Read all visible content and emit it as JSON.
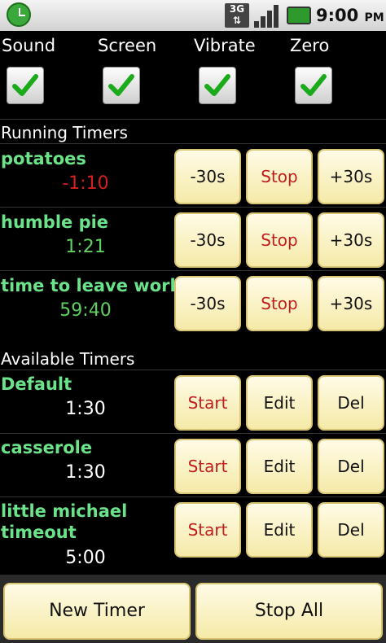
{
  "status_bar": {
    "network": "3G",
    "time": "9:00",
    "ampm": "PM"
  },
  "settings": {
    "sound": {
      "label": "Sound",
      "checked": true
    },
    "screen": {
      "label": "Screen",
      "checked": true
    },
    "vibrate": {
      "label": "Vibrate",
      "checked": true
    },
    "zero": {
      "label": "Zero",
      "checked": true
    }
  },
  "running_section": {
    "title": "Running Timers"
  },
  "running_timers": [
    {
      "name": "potatoes",
      "time": "-1:10",
      "time_color": "#d81f1f",
      "minus_label": "-30s",
      "stop_label": "Stop",
      "plus_label": "+30s"
    },
    {
      "name": "humble pie",
      "time": "1:21",
      "time_color": "#5fd05f",
      "minus_label": "-30s",
      "stop_label": "Stop",
      "plus_label": "+30s"
    },
    {
      "name": "time to leave work",
      "time": "59:40",
      "time_color": "#5fd05f",
      "minus_label": "-30s",
      "stop_label": "Stop",
      "plus_label": "+30s"
    }
  ],
  "available_section": {
    "title": "Available Timers"
  },
  "available_timers": [
    {
      "name": "Default",
      "time": "1:30",
      "start_label": "Start",
      "edit_label": "Edit",
      "del_label": "Del"
    },
    {
      "name": "casserole",
      "time": "1:30",
      "start_label": "Start",
      "edit_label": "Edit",
      "del_label": "Del"
    },
    {
      "name_line1": "little michael",
      "name_line2": "timeout",
      "time": "5:00",
      "start_label": "Start",
      "edit_label": "Edit",
      "del_label": "Del"
    }
  ],
  "bottom": {
    "new_timer_label": "New Timer",
    "stop_all_label": "Stop All"
  },
  "colors": {
    "timer_name": "#6be38a",
    "button_bg": "#fdf6cf",
    "button_red_text": "#c21d1d",
    "background": "#000000"
  }
}
